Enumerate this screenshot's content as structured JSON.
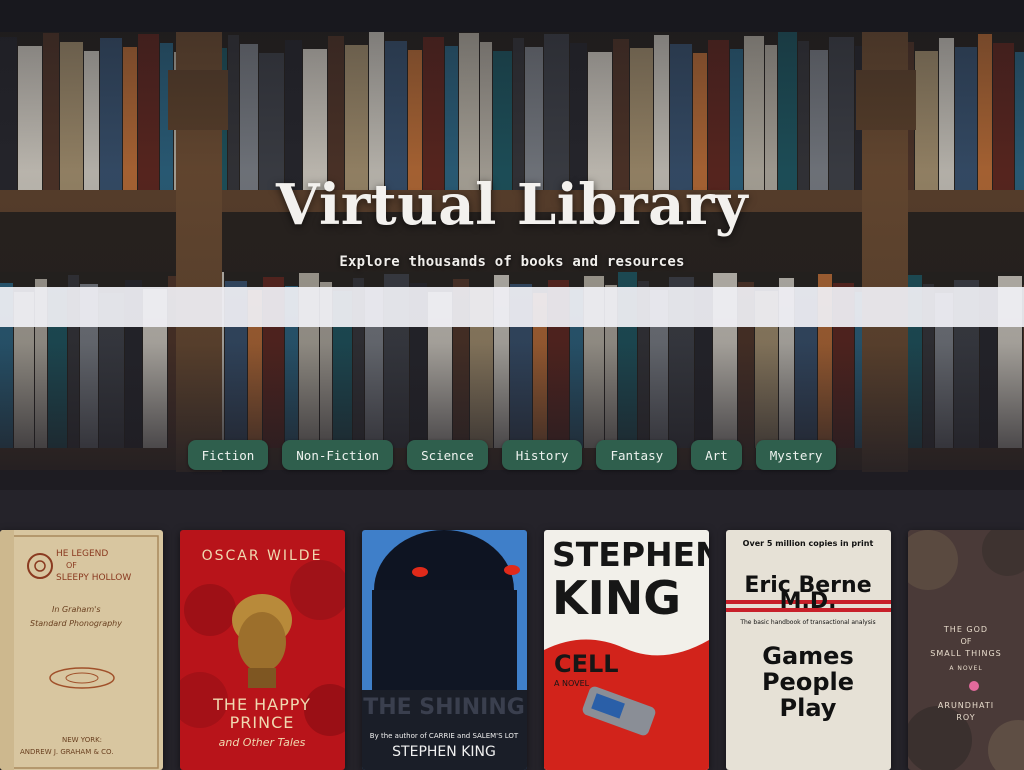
{
  "hero": {
    "title": "Virtual Library",
    "subtitle": "Explore thousands of books and resources"
  },
  "search": {
    "value": "",
    "placeholder": ""
  },
  "genres": [
    "Fiction",
    "Non-Fiction",
    "Science",
    "History",
    "Fantasy",
    "Art",
    "Mystery"
  ],
  "books": [
    {
      "cover_lines": [
        "HE LEGEND",
        "OF",
        "SLEEPY HOLLOW",
        "In Graham's",
        "Standard Phonography",
        "NEW YORK:",
        "ANDREW J. GRAHAM & CO."
      ],
      "colors": {
        "bg": "#d8c6a0",
        "ink": "#8a3a20"
      }
    },
    {
      "author": "OSCAR WILDE",
      "title": "THE HAPPY",
      "title2": "PRINCE",
      "subtitle": "and Other Tales",
      "colors": {
        "bg": "#b8141a",
        "ink": "#f0d9b0"
      }
    },
    {
      "title": "THE SHINING",
      "byline": "By the author of CARRIE and SALEM'S LOT",
      "author": "STEPHEN KING",
      "colors": {
        "bg": "#3f7fc9",
        "ink": "#ffffff"
      }
    },
    {
      "author1": "STEPHEN",
      "author2": "KING",
      "title": "CELL",
      "tag": "A NOVEL",
      "colors": {
        "bg": "#f2f0ea",
        "ink": "#161616",
        "accent": "#d2231b"
      }
    },
    {
      "tagline": "Over 5 million copies in print",
      "author1": "Eric Berne",
      "author2": "M.D.",
      "note": "The basic handbook of transactional analysis",
      "title1": "Games",
      "title2": "People",
      "title3": "Play",
      "colors": {
        "bg": "#e6e1d6",
        "ink": "#111111",
        "accent": "#c8202a"
      }
    },
    {
      "title1": "THE GOD",
      "title2": "OF",
      "title3": "SMALL THINGS",
      "tag": "A NOVEL",
      "author1": "ARUNDHATI",
      "author2": "ROY",
      "colors": {
        "bg": "#4a3a38",
        "ink": "#e8dccc"
      }
    }
  ]
}
